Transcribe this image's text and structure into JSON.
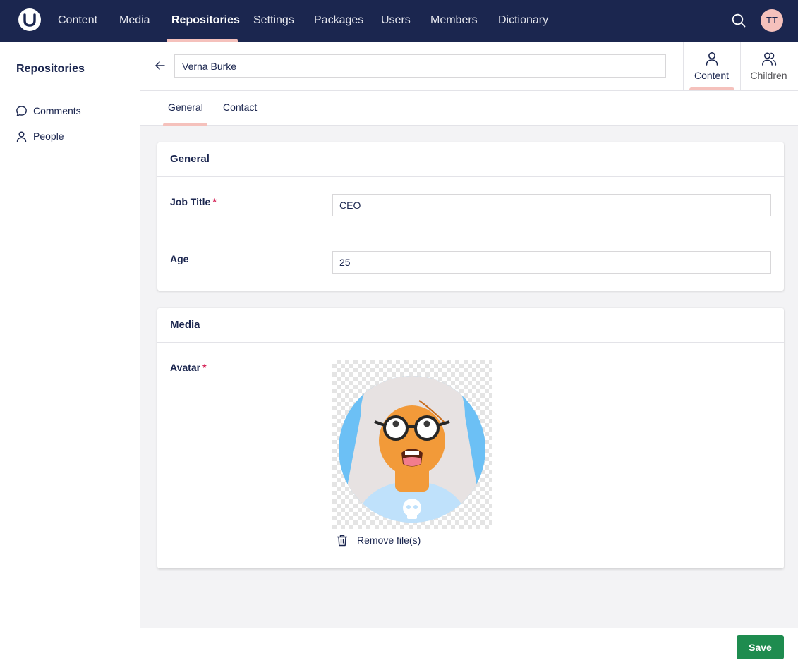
{
  "topnav": {
    "items": [
      {
        "label": "Content"
      },
      {
        "label": "Media"
      },
      {
        "label": "Repositories"
      },
      {
        "label": "Settings"
      },
      {
        "label": "Packages"
      },
      {
        "label": "Users"
      },
      {
        "label": "Members"
      },
      {
        "label": "Dictionary"
      }
    ],
    "active": "Repositories",
    "user_initials": "TT"
  },
  "sidebar": {
    "title": "Repositories",
    "items": [
      {
        "label": "Comments",
        "icon": "comment-icon"
      },
      {
        "label": "People",
        "icon": "person-icon"
      }
    ]
  },
  "header": {
    "name_value": "Verna Burke",
    "views": [
      {
        "label": "Content",
        "icon": "person-icon",
        "active": true
      },
      {
        "label": "Children",
        "icon": "people-icon",
        "active": false
      }
    ]
  },
  "tabs": [
    {
      "label": "General",
      "active": true
    },
    {
      "label": "Contact",
      "active": false
    }
  ],
  "general_group": {
    "title": "General",
    "job_title_label": "Job Title",
    "job_title_required": "*",
    "job_title_value": "CEO",
    "age_label": "Age",
    "age_value": "25"
  },
  "media_group": {
    "title": "Media",
    "avatar_label": "Avatar",
    "avatar_required": "*",
    "remove_label": "Remove file(s)"
  },
  "footer": {
    "save_label": "Save"
  },
  "colors": {
    "nav_bg": "#1b264f",
    "accent_pink": "#f5c1bc",
    "save_green": "#1e8c4f",
    "required_red": "#d42054",
    "page_bg": "#f3f3f5"
  }
}
